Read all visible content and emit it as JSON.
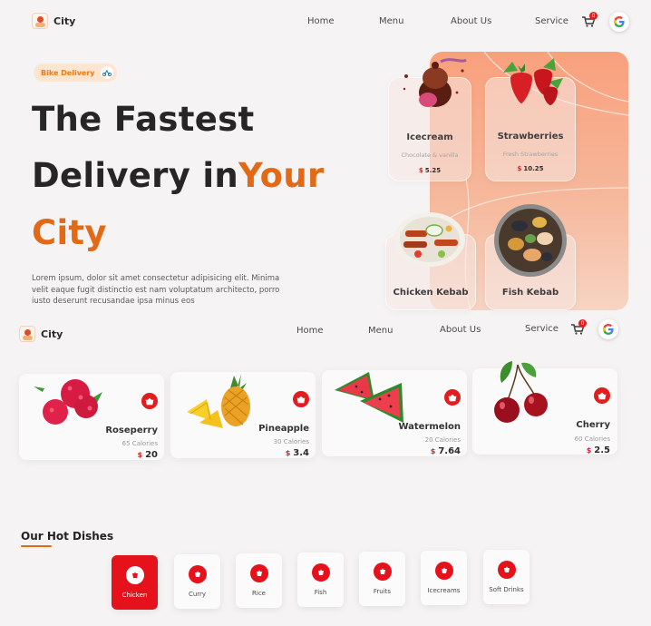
{
  "nav_top": {
    "brand": "City",
    "links": [
      "Home",
      "Menu",
      "About Us",
      "Service"
    ],
    "cart_count": "0"
  },
  "hero": {
    "pill": "Bike Delivery",
    "line1": "The Fastest",
    "line2_a": "Delivery in",
    "line2_b": "Your",
    "line3": "City",
    "description": "Lorem ipsum, dolor sit amet consectetur adipisicing elit. Minima velit eaque fugit distinctio est nam voluptatum architecto, porro iusto deserunt recusandae ipsa minus eos",
    "cards": [
      {
        "name": "Icecream",
        "sub": "Chocolate & vanilla",
        "currency": "$",
        "price": "5.25"
      },
      {
        "name": "Strawberries",
        "sub": "Fresh Strawberries",
        "currency": "$",
        "price": "10.25"
      },
      {
        "name": "Chicken Kebab",
        "sub": "",
        "currency": "",
        "price": ""
      },
      {
        "name": "Fish Kebab",
        "sub": "",
        "currency": "",
        "price": ""
      }
    ]
  },
  "nav_second": {
    "brand": "City",
    "links": [
      "Home",
      "Menu",
      "About Us",
      "Service"
    ],
    "cart_count": "0"
  },
  "fruits": [
    {
      "name": "Roseperry",
      "calories": "65 Calories",
      "currency": "$",
      "price": "20"
    },
    {
      "name": "Pineapple",
      "calories": "30 Calories",
      "currency": "$",
      "price": "3.4"
    },
    {
      "name": "Watermelon",
      "calories": "20 Calories",
      "currency": "$",
      "price": "7.64"
    },
    {
      "name": "Cherry",
      "calories": "60 Calories",
      "currency": "$",
      "price": "2.5"
    }
  ],
  "hot_dishes": {
    "title": "Our Hot Dishes",
    "categories": [
      "Chicken",
      "Curry",
      "Rice",
      "Fish",
      "Fruits",
      "Icecreams",
      "Soft Drinks"
    ],
    "active": "Chicken"
  },
  "colors": {
    "accent_orange": "#e26a17",
    "accent_red": "#e5121c",
    "hero_panel": "#f9a07d",
    "page_bg": "#f5f3f3"
  },
  "icons": [
    "cart-icon",
    "google-icon",
    "bike-icon",
    "food-category-icon"
  ]
}
